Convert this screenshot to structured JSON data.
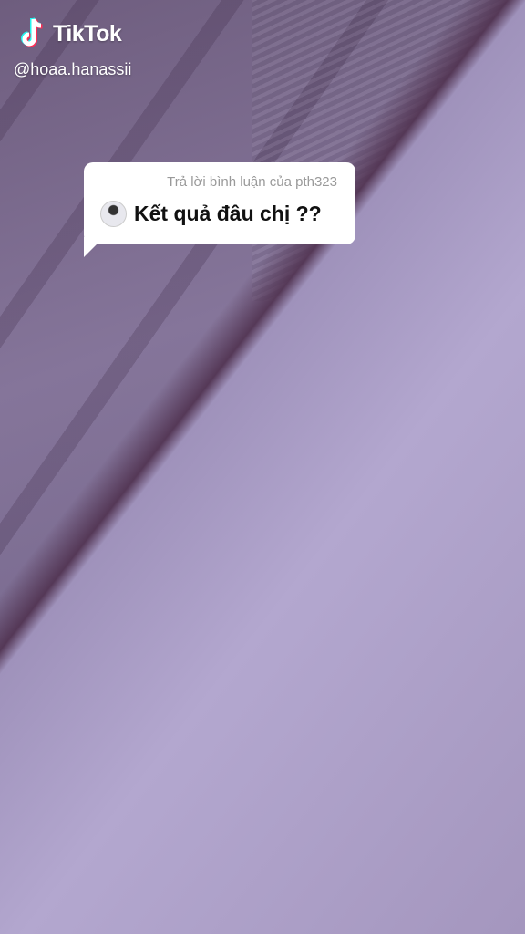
{
  "watermark": {
    "brand": "TikTok",
    "username": "@hoaa.hanassii"
  },
  "reply_bubble": {
    "reply_label": "Trả lời bình luận của pth323",
    "comment_text": "Kết quả đâu chị ??",
    "avatar_icon": "user-avatar"
  },
  "colors": {
    "tiktok_cyan": "#25F4EE",
    "tiktok_red": "#FE2C55"
  }
}
